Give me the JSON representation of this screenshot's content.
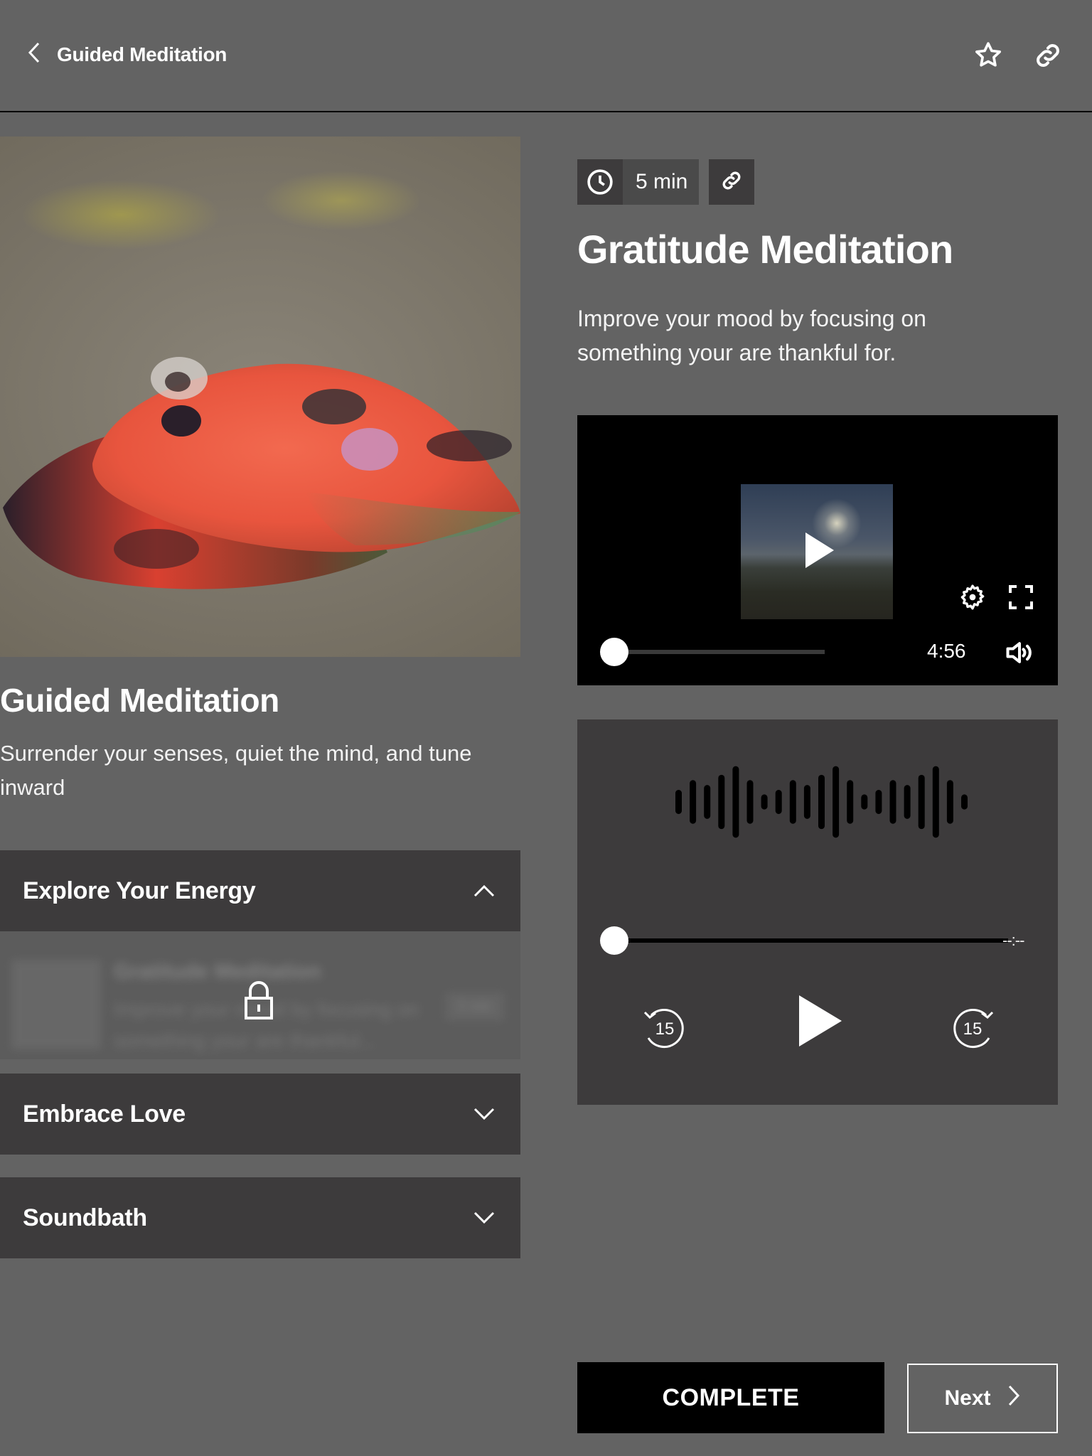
{
  "header": {
    "back_label": "Guided Meditation",
    "icons": [
      "chevron-left-icon",
      "star-icon",
      "link-icon"
    ]
  },
  "category": {
    "image_alt": "Red leaves on stone",
    "title": "Guided Meditation",
    "description": "Surrender your senses, quiet the mind, and tune inward"
  },
  "sections": [
    {
      "title": "Explore Your Energy",
      "expanded": true,
      "items": [
        {
          "title": "Gratitude Meditation",
          "description": "Improve your mood by focusing on something your are thankful...",
          "duration": "5 min",
          "locked": true
        }
      ]
    },
    {
      "title": "Embrace Love",
      "expanded": false
    },
    {
      "title": "Soundbath",
      "expanded": false
    }
  ],
  "lesson": {
    "duration": "5 min",
    "title": "Gratitude Meditation",
    "description": "Improve your mood by focusing on something your are thankful for."
  },
  "video_player": {
    "time_remaining": "4:56",
    "progress": 0,
    "icons": [
      "play-icon",
      "settings-icon",
      "fullscreen-icon",
      "volume-icon"
    ]
  },
  "audio_player": {
    "time": "--:--",
    "progress": 0,
    "skip_back_seconds": "15",
    "skip_forward_seconds": "15"
  },
  "actions": {
    "complete_label": "COMPLETE",
    "next_label": "Next"
  },
  "colors": {
    "background": "#636363",
    "panel": "#3d3b3c",
    "video_bg": "#000000",
    "text": "#ffffff"
  }
}
